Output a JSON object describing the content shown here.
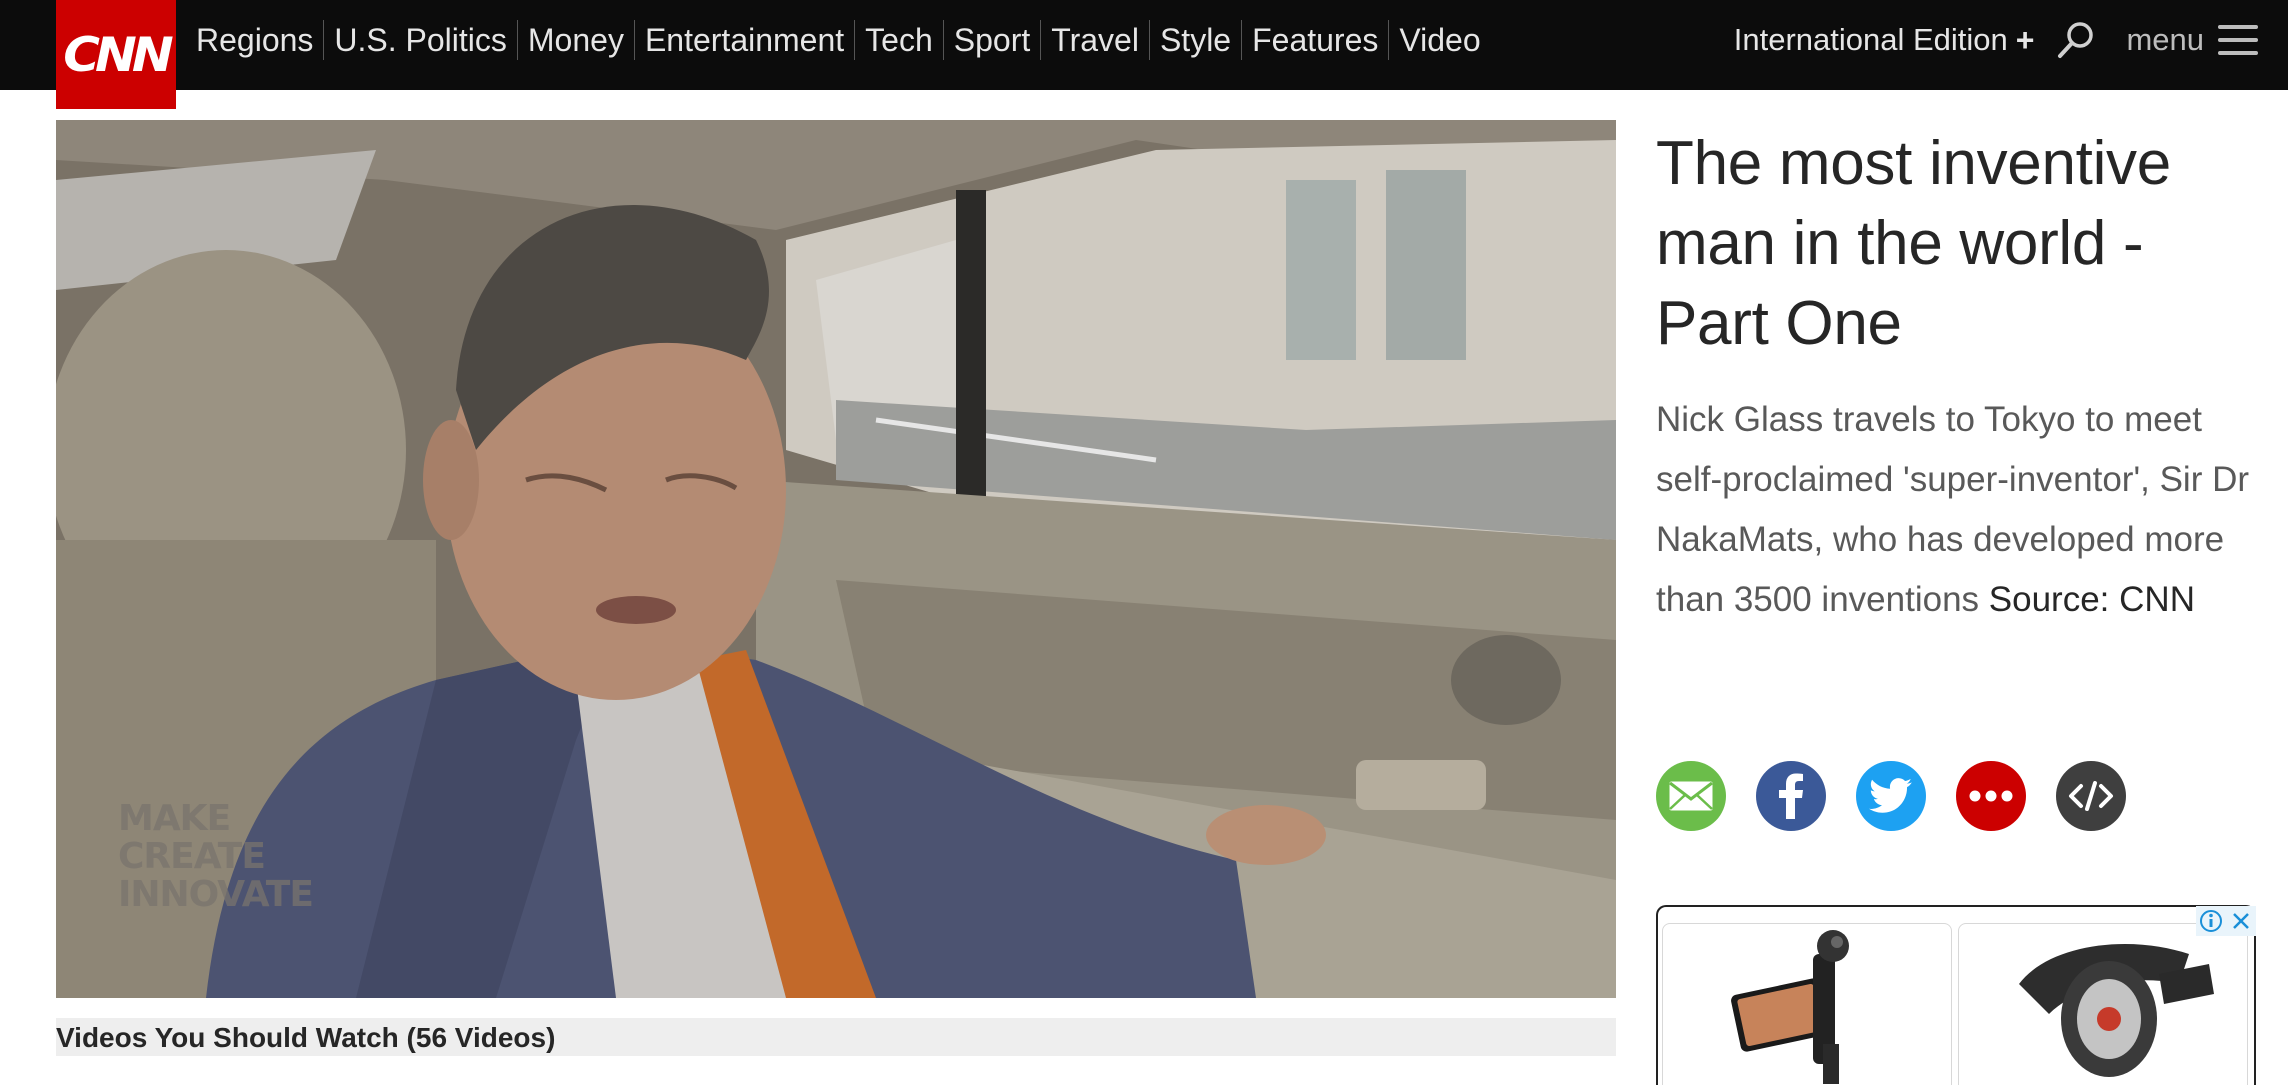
{
  "nav": {
    "logo": "CNN",
    "links": [
      "Regions",
      "U.S. Politics",
      "Money",
      "Entertainment",
      "Tech",
      "Sport",
      "Travel",
      "Style",
      "Features",
      "Video"
    ],
    "edition": "International Edition",
    "edition_plus": "+",
    "menu_label": "menu"
  },
  "video": {
    "watermark_lines": [
      "MAKE",
      "CREATE",
      "INNOVATE"
    ]
  },
  "playlist": {
    "title": "Videos You Should Watch (56 Videos)"
  },
  "article": {
    "headline": "The most inventive man in the world - Part One",
    "description": "Nick Glass travels to Tokyo to meet self-proclaimed 'super-inventor', Sir Dr NakaMats, who has developed more than 3500 inventions",
    "source_label": "Source:",
    "source_value": "CNN"
  },
  "share": {
    "buttons": [
      {
        "icon": "email-icon",
        "color": "#6bbd4a"
      },
      {
        "icon": "facebook-icon",
        "color": "#3b5998"
      },
      {
        "icon": "twitter-icon",
        "color": "#1da1f2"
      },
      {
        "icon": "more-icon",
        "color": "#cc0000"
      },
      {
        "icon": "embed-icon",
        "color": "#3f3f3f"
      }
    ]
  },
  "colors": {
    "brand_red": "#cc0000",
    "nav_bg": "#0c0c0c"
  }
}
